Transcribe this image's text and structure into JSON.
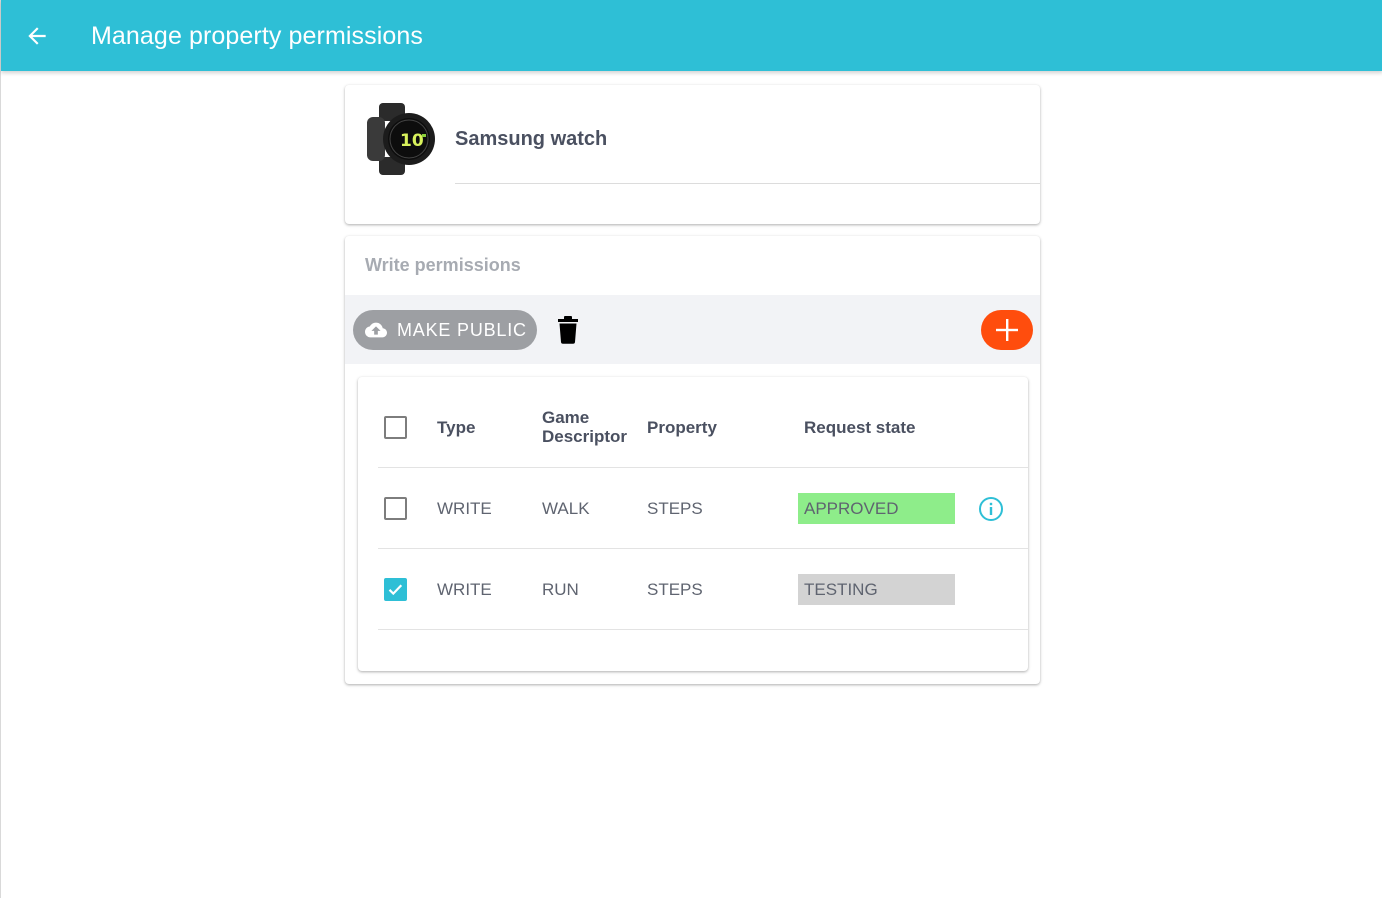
{
  "appbar": {
    "title": "Manage property permissions",
    "back_icon": "arrow-left-icon",
    "background": "#2ebfd6"
  },
  "device": {
    "name": "Samsung watch",
    "image": "smartwatch-image"
  },
  "permissions": {
    "title": "Write permissions",
    "make_public_label": "MAKE PUBLIC",
    "make_public_icon": "cloud-upload-icon",
    "delete_icon": "trash-icon",
    "add_icon": "plus-icon",
    "add_color": "#ff4d0d",
    "table": {
      "headers": {
        "type": "Type",
        "game_descriptor_line1": "Game",
        "game_descriptor_line2": "Descriptor",
        "property": "Property",
        "request_state": "Request state"
      },
      "select_all_checked": false,
      "rows": [
        {
          "checked": false,
          "type": "WRITE",
          "game_descriptor": "WALK",
          "property": "STEPS",
          "state": "APPROVED",
          "state_color": "#8eed8a",
          "info_icon": "info-icon"
        },
        {
          "checked": true,
          "type": "WRITE",
          "game_descriptor": "RUN",
          "property": "STEPS",
          "state": "TESTING",
          "state_color": "#d3d3d3"
        }
      ]
    }
  }
}
